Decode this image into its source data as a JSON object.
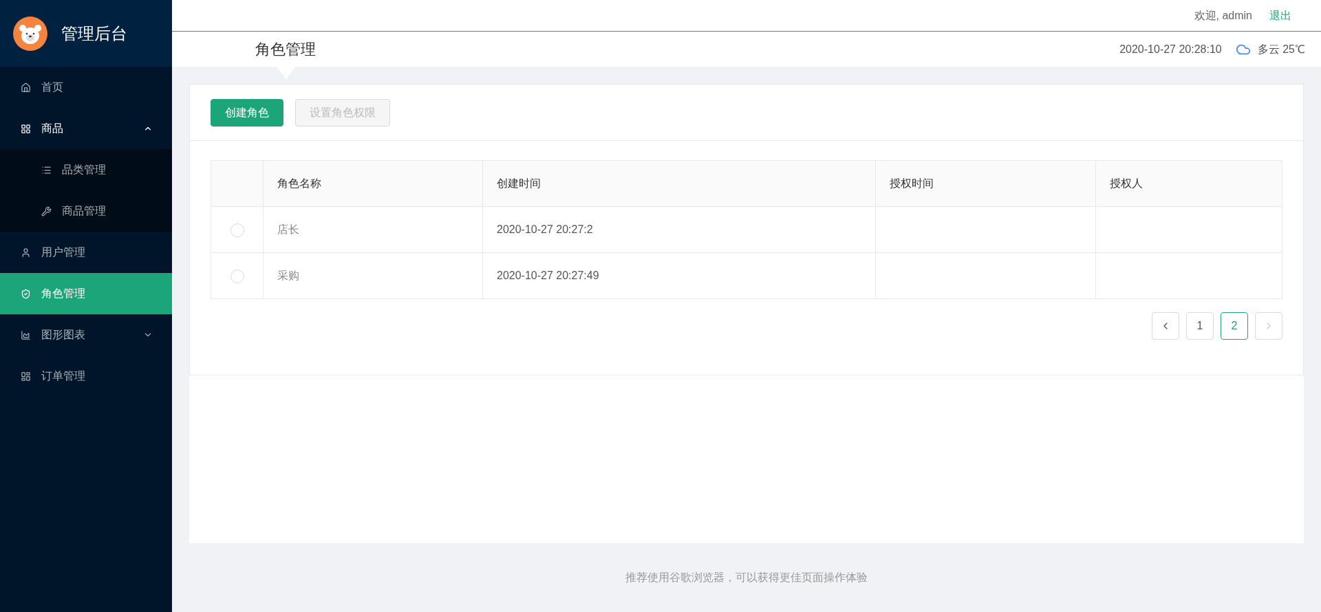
{
  "logo": {
    "title": "管理后台"
  },
  "sidebar": {
    "items": [
      {
        "label": "首页",
        "selected": false
      },
      {
        "label": "商品",
        "selected": false,
        "expanded": true,
        "children": [
          {
            "label": "品类管理",
            "selected": false
          },
          {
            "label": "商品管理",
            "selected": false
          }
        ]
      },
      {
        "label": "用户管理",
        "selected": false
      },
      {
        "label": "角色管理",
        "selected": true
      },
      {
        "label": "图形图表",
        "selected": false,
        "expanded": false
      },
      {
        "label": "订单管理",
        "selected": false
      }
    ]
  },
  "header": {
    "welcome": "欢迎, admin",
    "logout": "退出",
    "page_title": "角色管理",
    "datetime": "2020-10-27 20:28:10",
    "weather": "多云 25℃"
  },
  "toolbar": {
    "buttons": [
      {
        "label": "创建角色",
        "kind": "primary",
        "disabled": false
      },
      {
        "label": "设置角色权限",
        "kind": "default",
        "disabled": true
      }
    ]
  },
  "table": {
    "columns": [
      "角色名称",
      "创建时间",
      "授权时间",
      "授权人"
    ],
    "rows": [
      {
        "checked": false,
        "cells": [
          "店长",
          "2020-10-27 20:27:2",
          "",
          ""
        ]
      },
      {
        "checked": false,
        "cells": [
          "采购",
          "2020-10-27 20:27:49",
          "",
          ""
        ]
      }
    ]
  },
  "pagination": {
    "prev_disabled": false,
    "next_disabled": true,
    "pages": [
      {
        "label": "1",
        "selected": false
      },
      {
        "label": "2",
        "selected": true
      }
    ]
  },
  "footer": "推荐使用谷歌浏览器，可以获得更佳页面操作体验"
}
